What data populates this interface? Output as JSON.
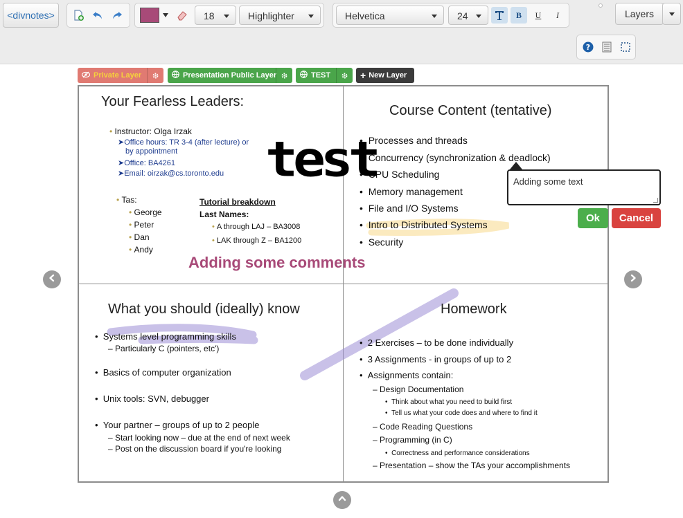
{
  "toolbar": {
    "logo": "<divnotes>",
    "color_swatch": "#a84a78",
    "font_size": "18",
    "tool": "Highlighter",
    "font_family": "Helvetica",
    "text_size": "24",
    "bold_label": "B",
    "underline_label": "U",
    "italic_label": "I",
    "layers_label": "Layers",
    "icons": [
      "new-page-icon",
      "undo-icon",
      "redo-icon",
      "eraser-icon",
      "text-style-icon",
      "help-icon",
      "notes-list-icon",
      "selection-icon"
    ]
  },
  "layers": [
    {
      "label": "Private Layer",
      "color": "#e07a72",
      "text_color": "#f5d23c"
    },
    {
      "label": "Presentation Public Layer",
      "color": "#4aa54a"
    },
    {
      "label": "TEST",
      "color": "#4aa54a"
    },
    {
      "label": "New Layer",
      "color": "#3b3b3b"
    }
  ],
  "slide": {
    "q1": {
      "title": "Your Fearless Leaders:",
      "instructor": "Instructor: Olga Irzak",
      "office_hours": "Office hours:  TR 3-4 (after lecture) or",
      "office_hours_2": "by appointment",
      "office": "Office: BA4261",
      "email": "Email: oirzak@cs.toronto.edu",
      "tas_label": "Tas:",
      "tas": [
        "George",
        "Peter",
        "Dan",
        "Andy"
      ],
      "tutorial_title": "Tutorial breakdown",
      "last_names": "Last Names:",
      "tutorials": [
        "A through LAJ – BA3008",
        "LAK through Z – BA1200"
      ]
    },
    "q2": {
      "title": "Course Content (tentative)",
      "items": [
        "Processes and threads",
        "Concurrency (synchronization & deadlock)",
        "CPU Scheduling",
        "Memory management",
        "File and I/O Systems",
        "Intro to Distributed Systems",
        "Security"
      ]
    },
    "q3": {
      "title": "What you should (ideally) know",
      "items": [
        "Systems level programming skills",
        "Basics of computer organization",
        "Unix tools: SVN, debugger",
        "Your partner – groups of up to 2 people"
      ],
      "sub_c": "Particularly C (pointers, etc')",
      "sub_partner": [
        "Start looking now – due at the end of next week",
        "Post on the discussion board if you're looking"
      ]
    },
    "q4": {
      "title": "Homework",
      "items": [
        "2 Exercises – to be done individually",
        "3 Assignments  - in groups of up to 2",
        "Assignments contain:"
      ],
      "sub": [
        "Design Documentation",
        "Code Reading Questions",
        "Programming (in C)",
        "Presentation – show the TAs your accomplishments"
      ],
      "design_sub": [
        "Think about what you need to build first",
        "Tell us what your code does and where to find it"
      ],
      "prog_sub": "Correctness and performance considerations"
    }
  },
  "annotations": {
    "handwriting": "test",
    "comment": "Adding some comments",
    "comment_color": "#a84a78"
  },
  "note": {
    "value": "Adding some text",
    "ok_label": "Ok",
    "cancel_label": "Cancel"
  }
}
